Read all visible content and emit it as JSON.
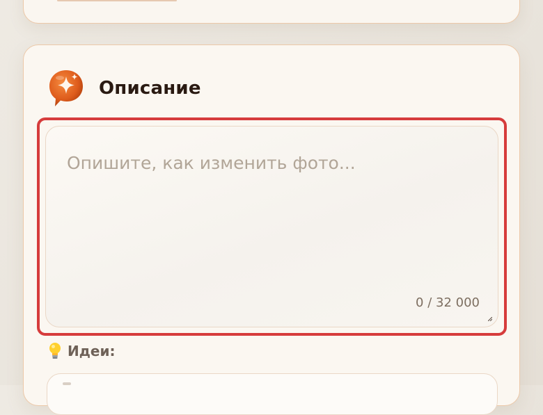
{
  "description_card": {
    "title": "Описание",
    "icon": "sparkle-speech-bubble-icon",
    "prompt_input": {
      "placeholder": "Опишите, как изменить фото...",
      "value": "",
      "counter": "0 / 32 000"
    },
    "ideas": {
      "icon": "lightbulb-icon",
      "label": "Идеи:"
    }
  },
  "colors": {
    "accent": "#e06a24",
    "highlight_border": "#d63c3c",
    "card_border": "#ecc8a8",
    "title_text": "#2a1a12",
    "placeholder_text": "#b1a597"
  }
}
